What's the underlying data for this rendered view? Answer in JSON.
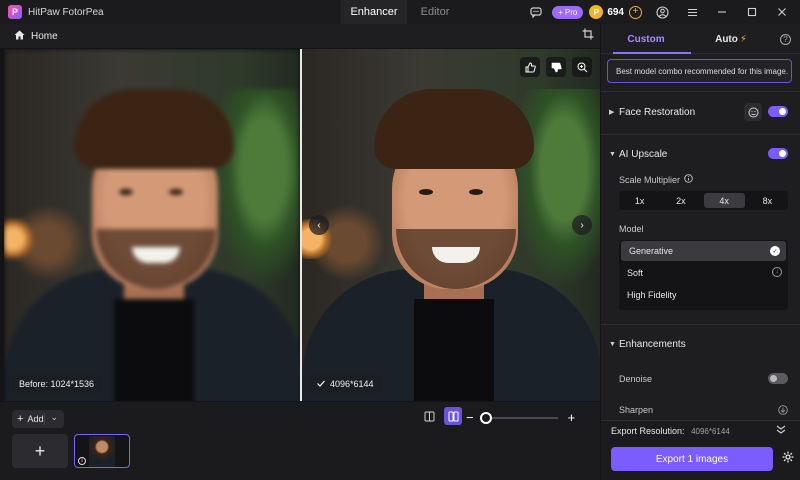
{
  "app": {
    "title": "HitPaw FotorPea",
    "logo_letter": "P",
    "tabs": [
      {
        "label": "Enhancer",
        "active": true
      },
      {
        "label": "Editor",
        "active": false
      }
    ],
    "pro_label": "+ Pro",
    "coin_symbol": "P",
    "coin_count": "694",
    "coin_plus": "+",
    "icons": [
      "chat-icon",
      "user-icon",
      "menu-icon",
      "minimize-icon",
      "maximize-icon",
      "close-icon"
    ]
  },
  "homebar": {
    "home_label": "Home"
  },
  "viewer": {
    "before_badge": "Before: 1024*1536",
    "after_badge": "4096*6144",
    "prev_arrow": "‹",
    "next_arrow": "›"
  },
  "bottombar": {
    "add_label": "Add",
    "add_plus": "+",
    "add_chevron": "⌄",
    "thumb_add": "+",
    "thumb_info": "i",
    "zoom_minus": "−",
    "zoom_plus": "+",
    "zoom_level": 0.0
  },
  "panel": {
    "tab_custom": "Custom",
    "tab_auto": "Auto",
    "tab_auto_icon": "⚡",
    "help": "?",
    "recommend_text": "Best model combo recommended for this image.",
    "face_restoration": {
      "title": "Face Restoration",
      "enabled": true
    },
    "ai_upscale": {
      "title": "AI Upscale",
      "enabled": true,
      "scale_label": "Scale Multiplier",
      "scale_options": [
        "1x",
        "2x",
        "4x",
        "8x"
      ],
      "scale_selected": "4x",
      "model_label": "Model",
      "models": [
        "Generative",
        "Soft",
        "High Fidelity"
      ],
      "model_selected": "Generative"
    },
    "enhancements": {
      "title": "Enhancements",
      "denoise_label": "Denoise",
      "denoise_enabled": false,
      "sharpen_label": "Sharpen"
    },
    "export": {
      "resolution_label": "Export Resolution:",
      "resolution_value": "4096*6144",
      "button_label": "Export 1 images"
    }
  },
  "colors": {
    "accent": "#7a5cff",
    "accent_text": "#a88bff",
    "coin": "#f2b325",
    "panel_bg": "#1e1e21"
  }
}
